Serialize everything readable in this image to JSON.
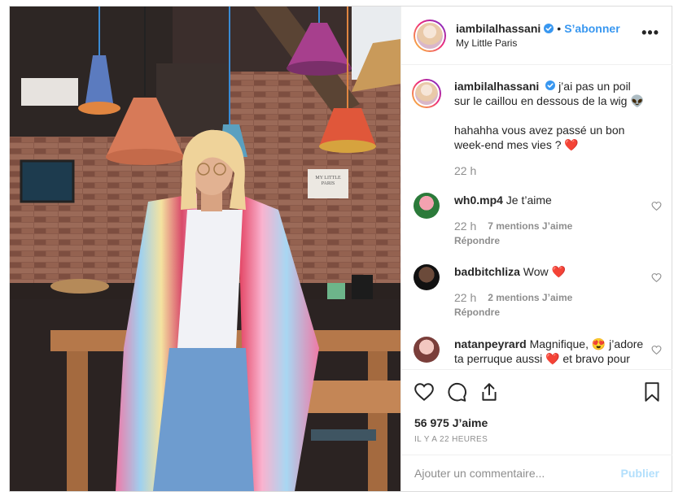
{
  "post": {
    "username": "iambilalhassani",
    "follow_label": "S’abonner",
    "dot": "•",
    "location": "My Little Paris",
    "more_label": "•••",
    "photo_sign": "MY LITTLE PARIS"
  },
  "caption": {
    "username": "iambilalhassani",
    "line1": "j’ai pas un poil sur le caillou en dessous de la wig 👽",
    "line2": "hahahha vous avez passé un bon week-end mes vies ? ❤️",
    "time": "22 h"
  },
  "comments": [
    {
      "username": "wh0.mp4",
      "text": "Je t’aime",
      "time": "22 h",
      "likes": "7 mentions J’aime",
      "reply": "Répondre"
    },
    {
      "username": "badbitchliza",
      "text": "Wow ❤️",
      "time": "22 h",
      "likes": "2 mentions J’aime",
      "reply": "Répondre"
    },
    {
      "username": "natanpeyrard",
      "text": "Magnifique, 😍 j’adore ta perruque aussi ❤️ et bravo pour les énergie Music",
      "time": "",
      "likes": "",
      "reply": ""
    }
  ],
  "footer": {
    "likes_count": "56 975 J’aime",
    "timestamp": "IL Y A 22 HEURES",
    "comment_placeholder": "Ajouter un commentaire...",
    "publish_label": "Publier"
  },
  "colors": {
    "accent": "#3897f0",
    "publish_disabled": "#b2dffc",
    "secondary_text": "#8e8e8e",
    "heart_emoji": "#e0245e"
  },
  "icons": [
    "verified-badge-icon",
    "more-options-icon",
    "heart-icon",
    "comment-icon",
    "share-icon",
    "bookmark-icon"
  ]
}
